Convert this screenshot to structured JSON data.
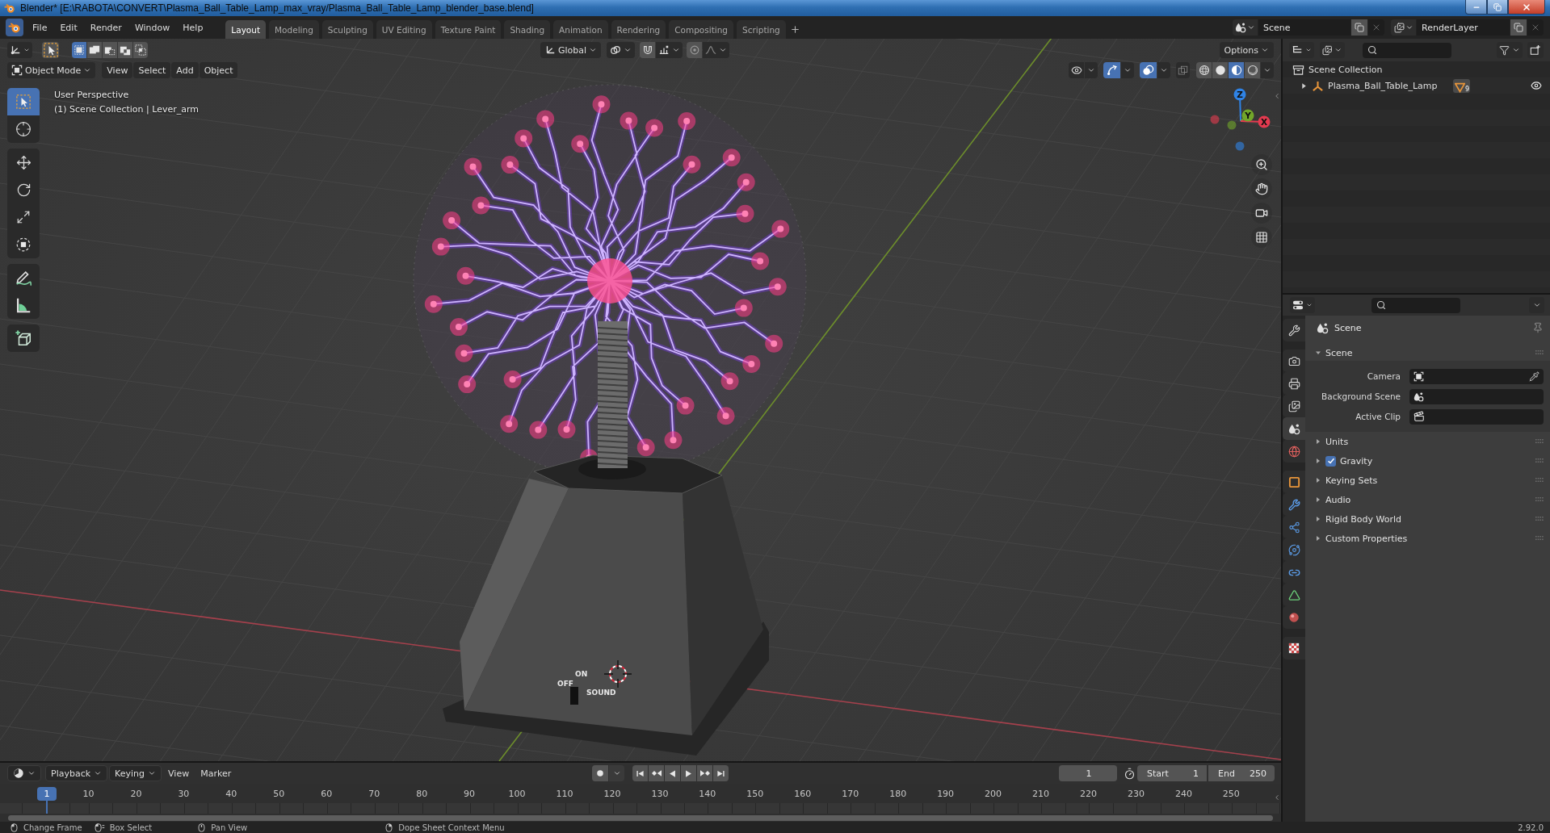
{
  "window": {
    "title": "Blender* [E:\\RABOTA\\CONVERT\\Plasma_Ball_Table_Lamp_max_vray/Plasma_Ball_Table_Lamp_blender_base.blend]"
  },
  "menu": [
    "File",
    "Edit",
    "Render",
    "Window",
    "Help"
  ],
  "workspaces": [
    {
      "label": "Layout",
      "selected": true
    },
    {
      "label": "Modeling",
      "selected": false
    },
    {
      "label": "Sculpting",
      "selected": false
    },
    {
      "label": "UV Editing",
      "selected": false
    },
    {
      "label": "Texture Paint",
      "selected": false
    },
    {
      "label": "Shading",
      "selected": false
    },
    {
      "label": "Animation",
      "selected": false
    },
    {
      "label": "Rendering",
      "selected": false
    },
    {
      "label": "Compositing",
      "selected": false
    },
    {
      "label": "Scripting",
      "selected": false
    }
  ],
  "scene": {
    "value": "Scene"
  },
  "view_layer": {
    "value": "RenderLayer"
  },
  "viewport": {
    "select_modes": [
      {
        "kind": "set",
        "selected": true
      },
      {
        "kind": "extend",
        "selected": false
      },
      {
        "kind": "subtract",
        "selected": false
      },
      {
        "kind": "difference",
        "selected": false
      },
      {
        "kind": "intersect",
        "selected": false
      }
    ],
    "orientation": "Global",
    "options": "Options",
    "mode": "Object Mode",
    "menus": [
      "View",
      "Select",
      "Add",
      "Object"
    ],
    "toggles": [
      {
        "kind": "visibility",
        "on": false
      },
      {
        "kind": "gizmos",
        "on": true
      },
      {
        "kind": "overlays",
        "on": true
      },
      {
        "kind": "xray",
        "on": false
      }
    ],
    "shading": [
      {
        "kind": "wireframe",
        "selected": false
      },
      {
        "kind": "solid",
        "selected": false
      },
      {
        "kind": "material",
        "selected": true
      },
      {
        "kind": "rendered",
        "selected": false
      }
    ],
    "info": [
      "User Perspective",
      "(1) Scene Collection | Lever_arm"
    ],
    "tool_groups": [
      [
        {
          "kind": "select",
          "selected": true
        },
        {
          "kind": "cursor",
          "selected": false
        }
      ],
      [
        {
          "kind": "move",
          "selected": false
        },
        {
          "kind": "rotate",
          "selected": false
        },
        {
          "kind": "scale",
          "selected": false
        },
        {
          "kind": "transform",
          "selected": false
        }
      ],
      [
        {
          "kind": "annotate",
          "selected": false
        },
        {
          "kind": "measure",
          "selected": false
        }
      ],
      [
        {
          "kind": "add_cube",
          "selected": false
        }
      ]
    ],
    "gizmo_axes": [
      {
        "label": "Z",
        "color": "#2f83e6"
      },
      {
        "label": "Y",
        "color": "#72a62a"
      },
      {
        "label": "X",
        "color": "#e43a4f"
      }
    ],
    "lamp_labels": [
      "ON",
      "OFF",
      "SOUND"
    ]
  },
  "outliner": {
    "items": [
      {
        "label": "Scene Collection",
        "kind": "collection",
        "children": [
          {
            "label": "Plasma_Ball_Table_Lamp",
            "kind": "object",
            "expanded": false,
            "badge": "9",
            "visible": true
          }
        ]
      }
    ]
  },
  "properties": {
    "tab_groups": [
      [
        {
          "kind": "tool",
          "selected": false
        }
      ],
      [
        {
          "kind": "render",
          "selected": false
        },
        {
          "kind": "output",
          "selected": false
        },
        {
          "kind": "view_layer",
          "selected": false
        },
        {
          "kind": "scene",
          "selected": true
        },
        {
          "kind": "world",
          "selected": false
        }
      ],
      [
        {
          "kind": "object",
          "selected": false
        },
        {
          "kind": "modifiers",
          "selected": false
        },
        {
          "kind": "particles",
          "selected": false
        },
        {
          "kind": "physics",
          "selected": false
        },
        {
          "kind": "constraints",
          "selected": false
        },
        {
          "kind": "data",
          "selected": false
        },
        {
          "kind": "material",
          "selected": false
        }
      ],
      [
        {
          "kind": "texture",
          "selected": false
        }
      ]
    ],
    "context": "Scene",
    "panels": [
      {
        "label": "Scene",
        "kind": "plain",
        "expanded": true,
        "fields": [
          {
            "label": "Camera",
            "kind": "object"
          },
          {
            "label": "Background Scene",
            "kind": "scene"
          },
          {
            "label": "Active Clip",
            "kind": "clip"
          }
        ]
      },
      {
        "label": "Units",
        "kind": "plain",
        "expanded": false
      },
      {
        "label": "Gravity",
        "kind": "toggle",
        "checked": true,
        "expanded": false
      },
      {
        "label": "Keying Sets",
        "kind": "plain",
        "expanded": false
      },
      {
        "label": "Audio",
        "kind": "plain",
        "expanded": false
      },
      {
        "label": "Rigid Body World",
        "kind": "plain",
        "expanded": false
      },
      {
        "label": "Custom Properties",
        "kind": "plain",
        "expanded": false
      }
    ]
  },
  "timeline": {
    "menus": [
      {
        "label": "Playback",
        "kind": "dropdown"
      },
      {
        "label": "Keying",
        "kind": "dropdown"
      },
      {
        "label": "View",
        "kind": "plain"
      },
      {
        "label": "Marker",
        "kind": "plain"
      }
    ],
    "frame": "1",
    "start": {
      "label": "Start",
      "value": "1"
    },
    "end": {
      "label": "End",
      "value": "250"
    },
    "playhead": "1",
    "ticks": [
      "10",
      "20",
      "30",
      "40",
      "50",
      "60",
      "70",
      "80",
      "90",
      "100",
      "110",
      "120",
      "130",
      "140",
      "150",
      "160",
      "170",
      "180",
      "190",
      "200",
      "210",
      "220",
      "230",
      "240",
      "250"
    ]
  },
  "status_bar": {
    "hints": [
      {
        "kind": "left",
        "label": "Change Frame"
      },
      {
        "kind": "drag",
        "label": "Box Select"
      },
      {
        "kind": "middle",
        "label": "Pan View"
      },
      {
        "kind": "right",
        "label": "Dope Sheet Context Menu"
      }
    ],
    "version": "2.92.0"
  }
}
